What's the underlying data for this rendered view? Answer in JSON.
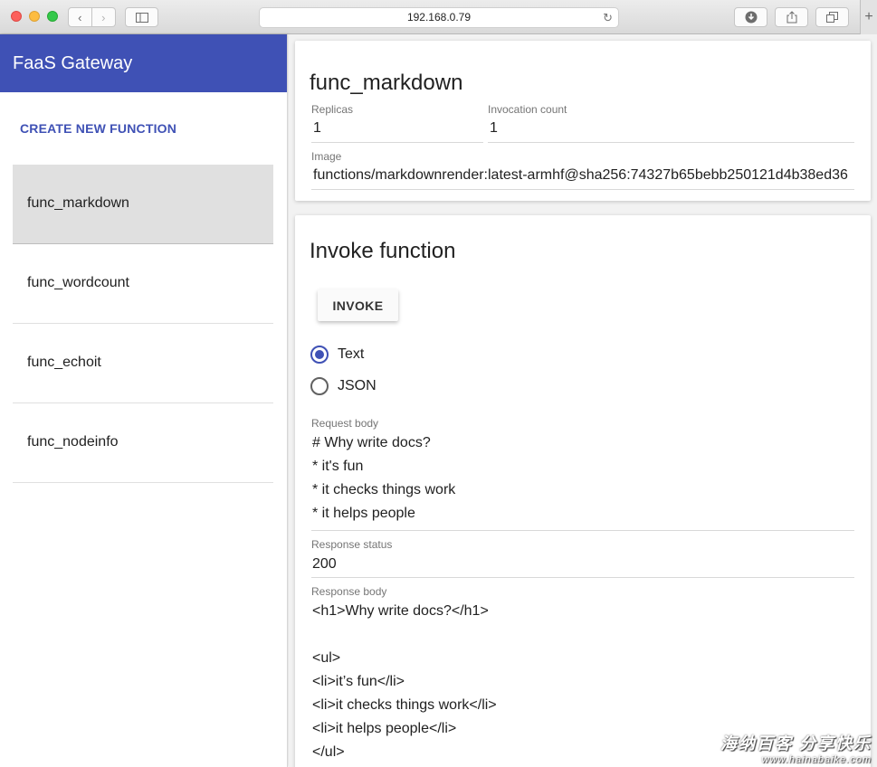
{
  "browser": {
    "url": "192.168.0.79",
    "reload_glyph": "↻",
    "back_glyph": "‹",
    "forward_glyph": "›",
    "new_tab_glyph": "+"
  },
  "sidebar": {
    "title": "FaaS Gateway",
    "create_label": "CREATE NEW FUNCTION",
    "functions": [
      "func_markdown",
      "func_wordcount",
      "func_echoit",
      "func_nodeinfo"
    ],
    "selected": "func_markdown"
  },
  "details": {
    "name": "func_markdown",
    "replicas_label": "Replicas",
    "replicas": "1",
    "invocation_label": "Invocation count",
    "invocation_count": "1",
    "image_label": "Image",
    "image": "functions/markdownrender:latest-armhf@sha256:74327b65bebb250121d4b38ed36"
  },
  "invoke": {
    "title": "Invoke function",
    "button_label": "INVOKE",
    "format_options": [
      "Text",
      "JSON"
    ],
    "selected_format": "Text",
    "request_label": "Request body",
    "request_body": "# Why write docs?\n* it's fun\n* it checks things work\n* it helps people",
    "status_label": "Response status",
    "status": "200",
    "response_label": "Response body",
    "response_body": "<h1>Why write docs?</h1>\n\n<ul>\n<li>it’s fun</li>\n<li>it checks things work</li>\n<li>it helps people</li>\n</ul>"
  },
  "watermark": {
    "line1": "海纳百客 分享快乐",
    "line2": "www.hainabaike.com"
  },
  "colors": {
    "accent": "#3f51b5",
    "sidebar_selected": "#e0e0e0"
  }
}
